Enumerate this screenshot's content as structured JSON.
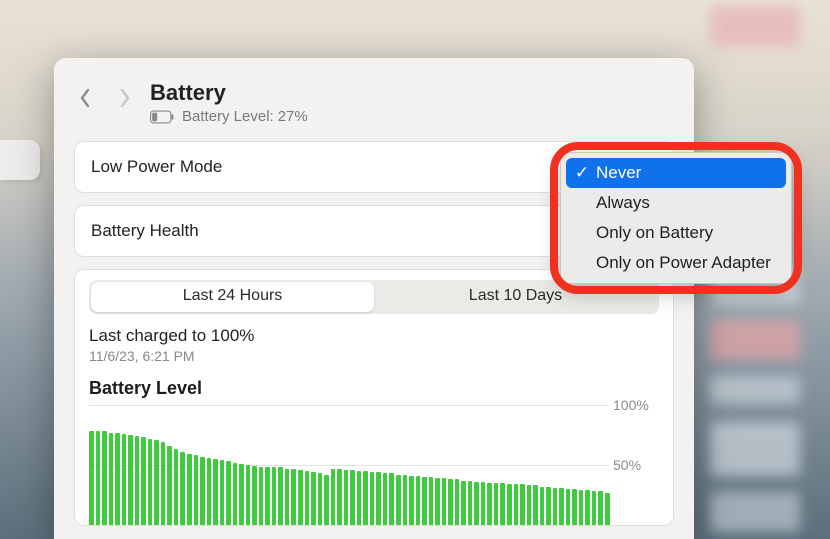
{
  "header": {
    "title": "Battery",
    "subtitle_prefix": "Battery Level:",
    "battery_percent": "27%"
  },
  "rows": {
    "low_power_mode_label": "Low Power Mode",
    "battery_health_label": "Battery Health"
  },
  "dropdown": {
    "options": [
      {
        "label": "Never",
        "selected": true
      },
      {
        "label": "Always",
        "selected": false
      },
      {
        "label": "Only on Battery",
        "selected": false
      },
      {
        "label": "Only on Power Adapter",
        "selected": false
      }
    ]
  },
  "segmented": {
    "items": [
      {
        "label": "Last 24 Hours",
        "active": true
      },
      {
        "label": "Last 10 Days",
        "active": false
      }
    ]
  },
  "last_charged": {
    "line": "Last charged to 100%",
    "time": "11/6/23, 6:21 PM"
  },
  "chart_title": "Battery Level",
  "y_ticks": [
    "100%",
    "50%"
  ],
  "chart_data": {
    "type": "bar",
    "title": "Battery Level",
    "xlabel": "",
    "ylabel": "",
    "ylim": [
      0,
      100
    ],
    "categories_note": "hourly/sub-hourly intervals over last 24 hours (labels not shown in viewport)",
    "values": [
      78,
      78,
      78,
      77,
      77,
      76,
      75,
      74,
      73,
      72,
      71,
      69,
      66,
      63,
      61,
      59,
      58,
      57,
      56,
      55,
      54,
      53,
      52,
      51,
      50,
      49,
      48,
      48,
      48,
      48,
      47,
      47,
      46,
      45,
      44,
      43,
      42,
      47,
      47,
      46,
      46,
      45,
      45,
      44,
      44,
      43,
      43,
      42,
      42,
      41,
      41,
      40,
      40,
      39,
      39,
      38,
      38,
      37,
      37,
      36,
      36,
      35,
      35,
      35,
      34,
      34,
      34,
      33,
      33,
      32,
      32,
      31,
      31,
      30,
      30,
      29,
      29,
      28,
      28,
      27
    ]
  }
}
